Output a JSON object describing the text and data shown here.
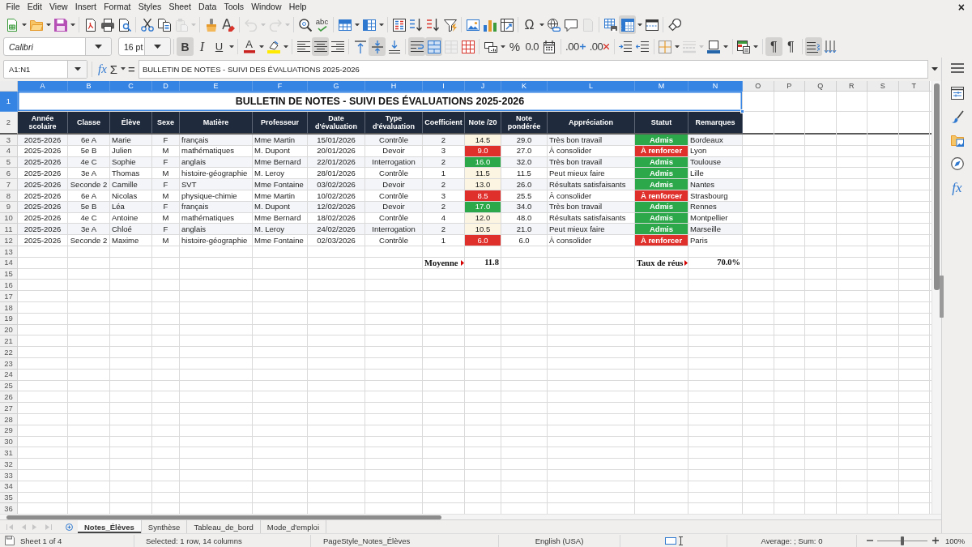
{
  "menu_bar": {
    "items": [
      "File",
      "Edit",
      "View",
      "Insert",
      "Format",
      "Styles",
      "Sheet",
      "Data",
      "Tools",
      "Window",
      "Help"
    ],
    "close": "×"
  },
  "standard_toolbar": {
    "groups": [
      [
        {
          "kind": "new",
          "pressed": false,
          "disabled": false
        },
        {
          "kind": "open",
          "pressed": false,
          "disabled": false
        },
        {
          "kind": "save",
          "pressed": false,
          "disabled": false
        }
      ],
      [
        {
          "kind": "pdf",
          "pressed": false,
          "disabled": false
        },
        {
          "kind": "print",
          "pressed": false,
          "disabled": false
        },
        {
          "kind": "preview",
          "pressed": false,
          "disabled": false
        }
      ],
      [
        {
          "kind": "cut",
          "pressed": false,
          "disabled": false
        },
        {
          "kind": "copy",
          "pressed": false,
          "disabled": false
        },
        {
          "kind": "paste",
          "pressed": false,
          "disabled": true
        }
      ],
      [
        {
          "kind": "clone",
          "pressed": false,
          "disabled": false
        },
        {
          "kind": "clear",
          "pressed": false,
          "disabled": false
        }
      ],
      [
        {
          "kind": "undo",
          "pressed": false,
          "disabled": true
        },
        {
          "kind": "redo",
          "pressed": false,
          "disabled": true
        }
      ],
      [
        {
          "kind": "find",
          "pressed": false,
          "disabled": false
        },
        {
          "kind": "spelling",
          "label": "abc",
          "pressed": false,
          "disabled": false
        }
      ],
      [
        {
          "kind": "rows",
          "pressed": false,
          "disabled": false
        },
        {
          "kind": "columns",
          "pressed": false,
          "disabled": false
        }
      ],
      [
        {
          "kind": "sort",
          "pressed": false,
          "disabled": false
        },
        {
          "kind": "sort_asc",
          "pressed": false,
          "disabled": false
        },
        {
          "kind": "sort_desc",
          "pressed": false,
          "disabled": false
        },
        {
          "kind": "filter",
          "pressed": false,
          "disabled": false
        }
      ],
      [
        {
          "kind": "image",
          "pressed": false,
          "disabled": false
        },
        {
          "kind": "chart",
          "pressed": false,
          "disabled": false
        },
        {
          "kind": "pivot",
          "pressed": false,
          "disabled": false
        }
      ],
      [
        {
          "kind": "special",
          "label": "Ω",
          "pressed": false,
          "disabled": false
        },
        {
          "kind": "link",
          "pressed": false,
          "disabled": false
        },
        {
          "kind": "comment",
          "pressed": false,
          "disabled": false
        },
        {
          "kind": "headers",
          "pressed": false,
          "disabled": true
        }
      ],
      [
        {
          "kind": "print_area",
          "pressed": false,
          "disabled": false
        },
        {
          "kind": "freeze",
          "pressed": true,
          "disabled": false
        },
        {
          "kind": "split",
          "pressed": false,
          "disabled": false
        }
      ],
      [
        {
          "kind": "shapes",
          "pressed": false,
          "disabled": false
        }
      ]
    ]
  },
  "formatting_toolbar": {
    "font_name": "Calibri",
    "font_size": "16 pt",
    "groups": [
      [
        {
          "kind": "bold",
          "label": "B",
          "pressed": true,
          "disabled": false
        },
        {
          "kind": "italic",
          "label": "I",
          "pressed": false,
          "disabled": false
        },
        {
          "kind": "underline",
          "label": "U",
          "pressed": false,
          "disabled": false
        }
      ],
      [
        {
          "kind": "font_color",
          "label": "A",
          "pressed": false,
          "disabled": false
        },
        {
          "kind": "highlight",
          "pressed": false,
          "disabled": false
        }
      ],
      [
        {
          "kind": "align_left",
          "pressed": false,
          "disabled": false
        },
        {
          "kind": "align_center",
          "pressed": true,
          "disabled": false
        },
        {
          "kind": "align_right",
          "pressed": false,
          "disabled": false
        }
      ],
      [
        {
          "kind": "align_top",
          "pressed": false,
          "disabled": false
        },
        {
          "kind": "align_middle",
          "pressed": true,
          "disabled": false
        },
        {
          "kind": "align_bottom",
          "pressed": false,
          "disabled": false
        }
      ],
      [
        {
          "kind": "wrap",
          "pressed": true,
          "disabled": false
        },
        {
          "kind": "merge_center",
          "pressed": true,
          "disabled": false
        },
        {
          "kind": "merge",
          "pressed": false,
          "disabled": true
        },
        {
          "kind": "unmerge",
          "pressed": false,
          "disabled": false
        }
      ],
      [
        {
          "kind": "currency",
          "pressed": false,
          "disabled": false
        },
        {
          "kind": "percent",
          "label": "%",
          "pressed": false,
          "disabled": false
        },
        {
          "kind": "number",
          "label": "0.0",
          "pressed": false,
          "disabled": false
        },
        {
          "kind": "date",
          "pressed": false,
          "disabled": false
        }
      ],
      [
        {
          "kind": "add_decimal",
          "label": ".00",
          "pressed": false,
          "disabled": false
        },
        {
          "kind": "del_decimal",
          "label": ".00",
          "pressed": false,
          "disabled": false
        }
      ],
      [
        {
          "kind": "indent_more",
          "pressed": false,
          "disabled": false
        },
        {
          "kind": "indent_less",
          "pressed": false,
          "disabled": false
        }
      ],
      [
        {
          "kind": "borders",
          "pressed": false,
          "disabled": false
        },
        {
          "kind": "border_style",
          "pressed": false,
          "disabled": true
        },
        {
          "kind": "border_color",
          "pressed": false,
          "disabled": false
        }
      ],
      [
        {
          "kind": "conditional",
          "pressed": false,
          "disabled": false
        }
      ],
      [
        {
          "kind": "ltr",
          "label": "¶",
          "pressed": true,
          "disabled": false
        },
        {
          "kind": "rtl",
          "label": "¶",
          "pressed": false,
          "disabled": false
        }
      ],
      [
        {
          "kind": "text_ltr",
          "pressed": true,
          "disabled": false
        },
        {
          "kind": "text_ttb",
          "pressed": false,
          "disabled": false
        }
      ]
    ]
  },
  "formula_bar": {
    "name_box": "A1:N1",
    "buttons": [
      {
        "kind": "function_wizard",
        "label": "fx"
      },
      {
        "kind": "sum",
        "label": "Σ"
      },
      {
        "kind": "formula",
        "label": "="
      }
    ],
    "content": "BULLETIN DE NOTES - SUIVI DES ÉVALUATIONS 2025-2026"
  },
  "sheet": {
    "column_headers": [
      {
        "label": "A",
        "selected": true
      },
      {
        "label": "B",
        "selected": true
      },
      {
        "label": "C",
        "selected": true
      },
      {
        "label": "D",
        "selected": true
      },
      {
        "label": "E",
        "selected": true
      },
      {
        "label": "F",
        "selected": true
      },
      {
        "label": "G",
        "selected": true
      },
      {
        "label": "H",
        "selected": true
      },
      {
        "label": "I",
        "selected": true
      },
      {
        "label": "J",
        "selected": true
      },
      {
        "label": "K",
        "selected": true
      },
      {
        "label": "L",
        "selected": true
      },
      {
        "label": "M",
        "selected": true
      },
      {
        "label": "N",
        "selected": true
      },
      {
        "label": "O",
        "selected": false
      },
      {
        "label": "P",
        "selected": false
      },
      {
        "label": "Q",
        "selected": false
      },
      {
        "label": "R",
        "selected": false
      },
      {
        "label": "S",
        "selected": false
      },
      {
        "label": "T",
        "selected": false
      }
    ],
    "row_headers": [
      {
        "label": "1",
        "selected": true
      },
      {
        "label": "2",
        "selected": false
      },
      {
        "label": "3",
        "selected": false
      },
      {
        "label": "4",
        "selected": false
      },
      {
        "label": "5",
        "selected": false
      },
      {
        "label": "6",
        "selected": false
      },
      {
        "label": "7",
        "selected": false
      },
      {
        "label": "8",
        "selected": false
      },
      {
        "label": "9",
        "selected": false
      },
      {
        "label": "10",
        "selected": false
      },
      {
        "label": "11",
        "selected": false
      },
      {
        "label": "12",
        "selected": false
      },
      {
        "label": "13",
        "selected": false
      },
      {
        "label": "14",
        "selected": false
      },
      {
        "label": "15",
        "selected": false
      },
      {
        "label": "16",
        "selected": false
      },
      {
        "label": "17",
        "selected": false
      },
      {
        "label": "18",
        "selected": false
      },
      {
        "label": "19",
        "selected": false
      },
      {
        "label": "20",
        "selected": false
      },
      {
        "label": "21",
        "selected": false
      },
      {
        "label": "22",
        "selected": false
      },
      {
        "label": "23",
        "selected": false
      },
      {
        "label": "24",
        "selected": false
      },
      {
        "label": "25",
        "selected": false
      },
      {
        "label": "26",
        "selected": false
      },
      {
        "label": "27",
        "selected": false
      },
      {
        "label": "28",
        "selected": false
      },
      {
        "label": "29",
        "selected": false
      },
      {
        "label": "30",
        "selected": false
      },
      {
        "label": "31",
        "selected": false
      },
      {
        "label": "32",
        "selected": false
      },
      {
        "label": "33",
        "selected": false
      },
      {
        "label": "34",
        "selected": false
      },
      {
        "label": "35",
        "selected": false
      },
      {
        "label": "36",
        "selected": false
      }
    ],
    "title": "BULLETIN DE NOTES - SUIVI DES ÉVALUATIONS 2025-2026",
    "columns": [
      "Année scolaire",
      "Classe",
      "Élève",
      "Sexe",
      "Matière",
      "Professeur",
      "Date d'évaluation",
      "Type d'évaluation",
      "Coefficient",
      "Note /20",
      "Note pondérée",
      "Appréciation",
      "Statut",
      "Remarques"
    ],
    "rows": [
      {
        "year": "2025-2026",
        "class": "6e A",
        "student": "Marie",
        "sex": "F",
        "subject": "français",
        "teacher": "Mme Martin",
        "date": "15/01/2026",
        "type": "Contrôle",
        "coefficient": "2",
        "grade": {
          "text": "14.5",
          "color": "#fcf5e1"
        },
        "weighted_grade": "29.0",
        "appreciation": "Très bon travail",
        "status": {
          "text": "Admis",
          "color": "#2ca84a"
        },
        "remarks": "Bordeaux"
      },
      {
        "year": "2025-2026",
        "class": "5e B",
        "student": "Julien",
        "sex": "M",
        "subject": "mathématiques",
        "teacher": "M. Dupont",
        "date": "20/01/2026",
        "type": "Devoir",
        "coefficient": "3",
        "grade": {
          "text": "9.0",
          "color": "#e0302c"
        },
        "weighted_grade": "27.0",
        "appreciation": "À consolider",
        "status": {
          "text": "À renforcer",
          "color": "#e0302c"
        },
        "remarks": "Lyon"
      },
      {
        "year": "2025-2026",
        "class": "4e C",
        "student": "Sophie",
        "sex": "F",
        "subject": "anglais",
        "teacher": "Mme Bernard",
        "date": "22/01/2026",
        "type": "Interrogation",
        "coefficient": "2",
        "grade": {
          "text": "16.0",
          "color": "#2ca84a"
        },
        "weighted_grade": "32.0",
        "appreciation": "Très bon travail",
        "status": {
          "text": "Admis",
          "color": "#2ca84a"
        },
        "remarks": "Toulouse"
      },
      {
        "year": "2025-2026",
        "class": "3e A",
        "student": "Thomas",
        "sex": "M",
        "subject": "histoire-géographie",
        "teacher": "M. Leroy",
        "date": "28/01/2026",
        "type": "Contrôle",
        "coefficient": "1",
        "grade": {
          "text": "11.5",
          "color": "#fcf5e1"
        },
        "weighted_grade": "11.5",
        "appreciation": "Peut mieux faire",
        "status": {
          "text": "Admis",
          "color": "#2ca84a"
        },
        "remarks": "Lille"
      },
      {
        "year": "2025-2026",
        "class": "Seconde 2",
        "student": "Camille",
        "sex": "F",
        "subject": "SVT",
        "teacher": "Mme Fontaine",
        "date": "03/02/2026",
        "type": "Devoir",
        "coefficient": "2",
        "grade": {
          "text": "13.0",
          "color": "#fcf5e1"
        },
        "weighted_grade": "26.0",
        "appreciation": "Résultats satisfaisants",
        "status": {
          "text": "Admis",
          "color": "#2ca84a"
        },
        "remarks": "Nantes"
      },
      {
        "year": "2025-2026",
        "class": "6e A",
        "student": "Nicolas",
        "sex": "M",
        "subject": "physique-chimie",
        "teacher": "Mme Martin",
        "date": "10/02/2026",
        "type": "Contrôle",
        "coefficient": "3",
        "grade": {
          "text": "8.5",
          "color": "#e0302c"
        },
        "weighted_grade": "25.5",
        "appreciation": "À consolider",
        "status": {
          "text": "À renforcer",
          "color": "#e0302c"
        },
        "remarks": "Strasbourg"
      },
      {
        "year": "2025-2026",
        "class": "5e B",
        "student": "Léa",
        "sex": "F",
        "subject": "français",
        "teacher": "M. Dupont",
        "date": "12/02/2026",
        "type": "Devoir",
        "coefficient": "2",
        "grade": {
          "text": "17.0",
          "color": "#2ca84a"
        },
        "weighted_grade": "34.0",
        "appreciation": "Très bon travail",
        "status": {
          "text": "Admis",
          "color": "#2ca84a"
        },
        "remarks": "Rennes"
      },
      {
        "year": "2025-2026",
        "class": "4e C",
        "student": "Antoine",
        "sex": "M",
        "subject": "mathématiques",
        "teacher": "Mme Bernard",
        "date": "18/02/2026",
        "type": "Contrôle",
        "coefficient": "4",
        "grade": {
          "text": "12.0",
          "color": "#fcf5e1"
        },
        "weighted_grade": "48.0",
        "appreciation": "Résultats satisfaisants",
        "status": {
          "text": "Admis",
          "color": "#2ca84a"
        },
        "remarks": "Montpellier"
      },
      {
        "year": "2025-2026",
        "class": "3e A",
        "student": "Chloé",
        "sex": "F",
        "subject": "anglais",
        "teacher": "M. Leroy",
        "date": "24/02/2026",
        "type": "Interrogation",
        "coefficient": "2",
        "grade": {
          "text": "10.5",
          "color": "#fcf5e1"
        },
        "weighted_grade": "21.0",
        "appreciation": "Peut mieux faire",
        "status": {
          "text": "Admis",
          "color": "#2ca84a"
        },
        "remarks": "Marseille"
      },
      {
        "year": "2025-2026",
        "class": "Seconde 2",
        "student": "Maxime",
        "sex": "M",
        "subject": "histoire-géographie",
        "teacher": "Mme Fontaine",
        "date": "02/03/2026",
        "type": "Contrôle",
        "coefficient": "1",
        "grade": {
          "text": "6.0",
          "color": "#e0302c"
        },
        "weighted_grade": "6.0",
        "appreciation": "À consolider",
        "status": {
          "text": "À renforcer",
          "color": "#e0302c"
        },
        "remarks": "Paris"
      }
    ],
    "summary": [
      {
        "label": "Moyenne",
        "value": "11.8",
        "truncated": true
      },
      {
        "label": "Taux de réus",
        "value": "70.0%",
        "truncated": true
      }
    ]
  },
  "sheet_tabs": {
    "navigation": [
      {
        "kind": "first",
        "disabled": true
      },
      {
        "kind": "previous",
        "disabled": true
      },
      {
        "kind": "next",
        "disabled": true
      },
      {
        "kind": "last",
        "disabled": true
      }
    ],
    "tabs": [
      {
        "label": "Notes_Élèves",
        "selected": true
      },
      {
        "label": "Synthèse",
        "selected": false
      },
      {
        "label": "Tableau_de_bord",
        "selected": false
      },
      {
        "label": "Mode_d'emploi",
        "selected": false
      }
    ]
  },
  "sidebar": {
    "buttons": [
      {
        "kind": "menu"
      },
      {
        "kind": "properties"
      },
      {
        "kind": "styles"
      },
      {
        "kind": "gallery"
      },
      {
        "kind": "navigator"
      },
      {
        "kind": "functions",
        "label": "fx"
      }
    ]
  },
  "status_bar": {
    "sheet": "Sheet 1 of 4",
    "selection": "Selected: 1 row, 14 columns",
    "page_style": "PageStyle_Notes_Élèves",
    "language": "English (USA)",
    "statistics": "Average: ; Sum: 0",
    "zoom": {
      "level": 0.5,
      "reading": "100%"
    }
  }
}
